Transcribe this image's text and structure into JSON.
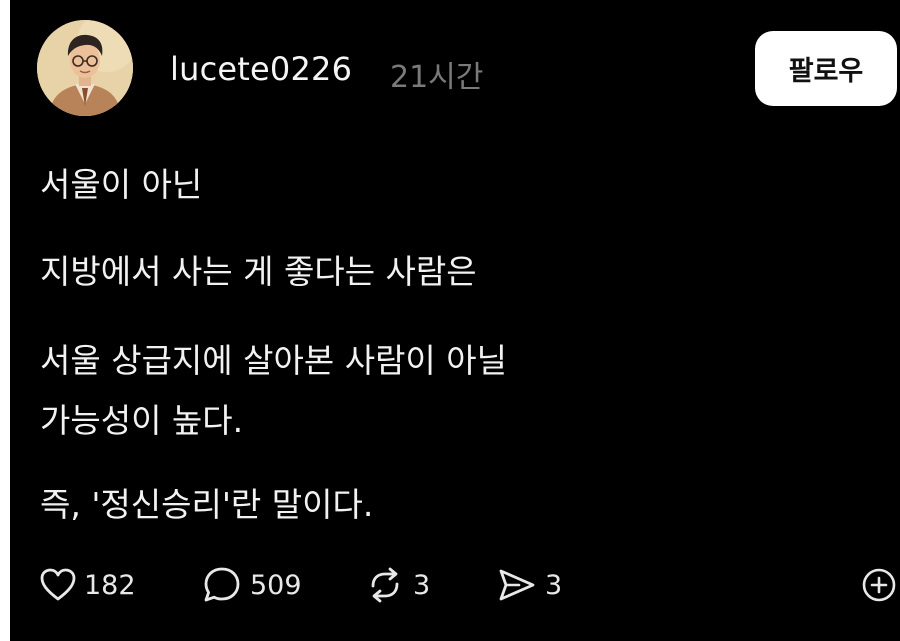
{
  "post": {
    "username": "lucete0226",
    "time_ago": "21시간",
    "follow_label": "팔로우",
    "content_lines": [
      "서울이 아닌",
      "지방에서 사는 게 좋다는 사람은",
      "서울 상급지에 살아본 사람이 아닐",
      "가능성이 높다.",
      "즉, '정신승리'란 말이다."
    ]
  },
  "actions": {
    "likes": "182",
    "comments": "509",
    "reposts": "3",
    "shares": "3"
  },
  "icons": {
    "like": "heart-icon",
    "comment": "comment-bubble-icon",
    "repost": "repost-icon",
    "share": "send-icon",
    "more": "plus-circle-icon"
  },
  "colors": {
    "background": "#000000",
    "text": "#f2f2f2",
    "muted": "#7a7a7a",
    "button_bg": "#ffffff"
  }
}
